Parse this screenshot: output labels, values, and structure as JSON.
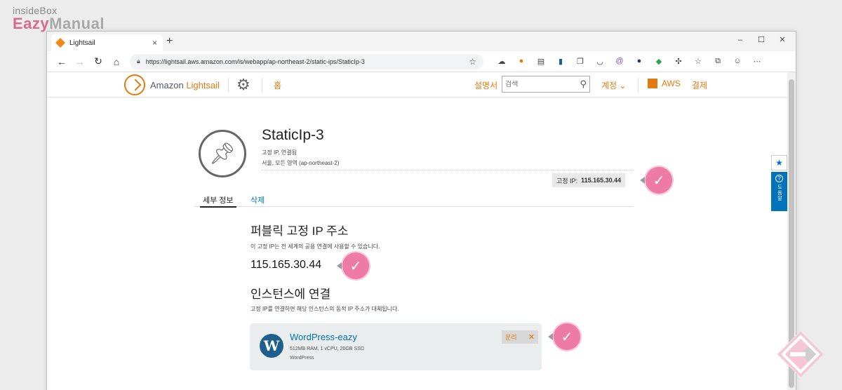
{
  "watermark": {
    "line1": "insideBox",
    "line2a": "Eazy",
    "line2b": "Manual"
  },
  "browser": {
    "tab_title": "Lightsail",
    "tab_close": "×",
    "new_tab": "+",
    "url": "https://lightsail.aws.amazon.com/ls/webapp/ap-northeast-2/static-ips/StaticIp-3",
    "min": "–",
    "max": "☐",
    "close": "✕"
  },
  "header": {
    "brand_a": "Amazon ",
    "brand_b": "Lightsail",
    "home": "홈",
    "guide": "설명서",
    "search_placeholder": "검색",
    "account": "계정 ⌄",
    "aws": "AWS",
    "billing": "결제"
  },
  "resource": {
    "name": "StaticIp-3",
    "status": "고정 IP, 연결됨",
    "region": "서울, 모든 영역 (ap-northeast-2)",
    "ip_label": "고정 IP:",
    "ip_value": "115.165.30.44"
  },
  "tabs": {
    "details": "세부 정보",
    "delete": "삭제"
  },
  "public_ip": {
    "heading": "퍼블릭 고정 IP 주소",
    "desc": "이 고정 IP는 전 세계의 공용 연결에 사용할 수 있습니다.",
    "value": "115.165.30.44"
  },
  "attach": {
    "heading": "인스턴스에 연결",
    "desc": "고정 IP를 연결하면 해당 인스턴스의 동적 IP 주소가 대체됩니다."
  },
  "instance": {
    "name": "WordPress-eazy",
    "spec": "512MB RAM, 1 vCPU, 20GB SSD",
    "os": "WordPress",
    "detach": "분리",
    "detach_x": "✕"
  },
  "side": {
    "help": "도움말"
  },
  "colors": {
    "accent": "#e47911",
    "link": "#0073bb",
    "mark": "#ee7ba5"
  }
}
